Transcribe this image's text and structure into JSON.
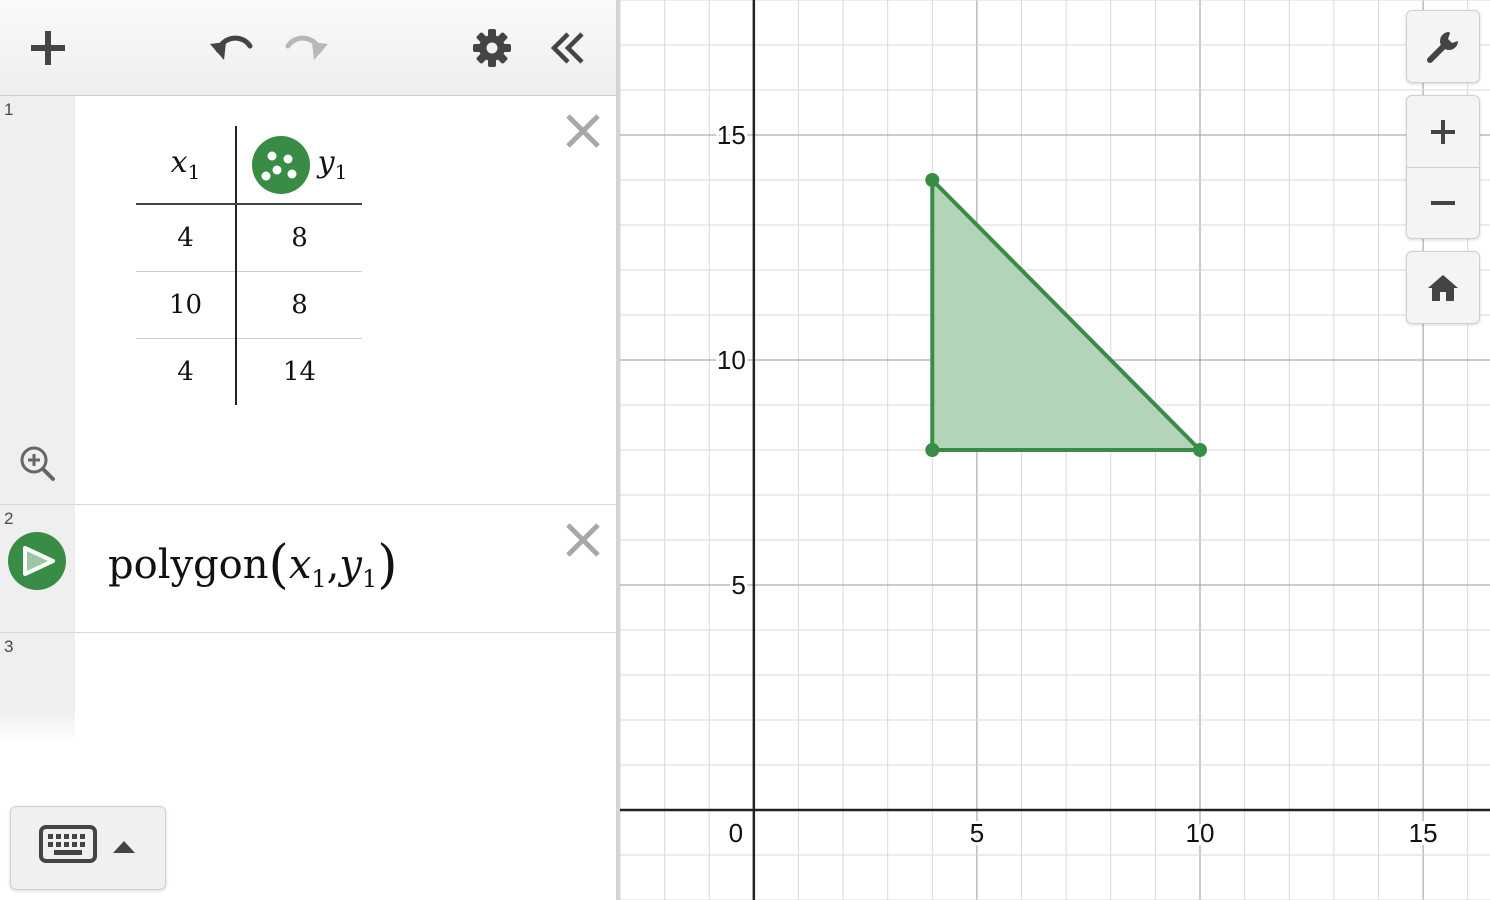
{
  "expressions": [
    {
      "index": "1",
      "type": "table",
      "columns": [
        {
          "name": "x",
          "sub": "1"
        },
        {
          "name": "y",
          "sub": "1"
        }
      ],
      "rows": [
        [
          "4",
          "8"
        ],
        [
          "10",
          "8"
        ],
        [
          "4",
          "14"
        ]
      ],
      "color": "#388c46"
    },
    {
      "index": "2",
      "type": "expression",
      "func": "polygon",
      "arg1": {
        "name": "x",
        "sub": "1"
      },
      "arg2": {
        "name": "y",
        "sub": "1"
      },
      "color": "#388c46"
    },
    {
      "index": "3",
      "type": "empty"
    }
  ],
  "icons": {
    "add": "plus-icon",
    "undo": "undo-icon",
    "redo": "redo-icon",
    "settings": "gear-icon",
    "collapse": "double-chevron-left-icon",
    "close": "close-icon",
    "zoom_fit": "zoom-in-icon",
    "points_style": "points-style-icon",
    "polygon_style": "play-triangle-icon",
    "keyboard": "keyboard-icon",
    "keyboard_toggle": "caret-up-icon",
    "graph_settings": "wrench-icon",
    "zoom_in": "plus-icon",
    "zoom_out": "minus-icon",
    "home": "home-icon"
  },
  "colors": {
    "accent_green": "#388c46",
    "fill_green": "#b3d4b7",
    "redo_disabled": "#b8b8b8"
  },
  "graph": {
    "x_range": [
      -3,
      16.5
    ],
    "y_range": [
      -2,
      18
    ],
    "major_step": 5,
    "minor_step": 1,
    "x_tick_labels": [
      "0",
      "5",
      "10",
      "15"
    ],
    "y_tick_labels": [
      "5",
      "10",
      "15"
    ],
    "polygon": [
      [
        4,
        8
      ],
      [
        10,
        8
      ],
      [
        4,
        14
      ]
    ]
  }
}
